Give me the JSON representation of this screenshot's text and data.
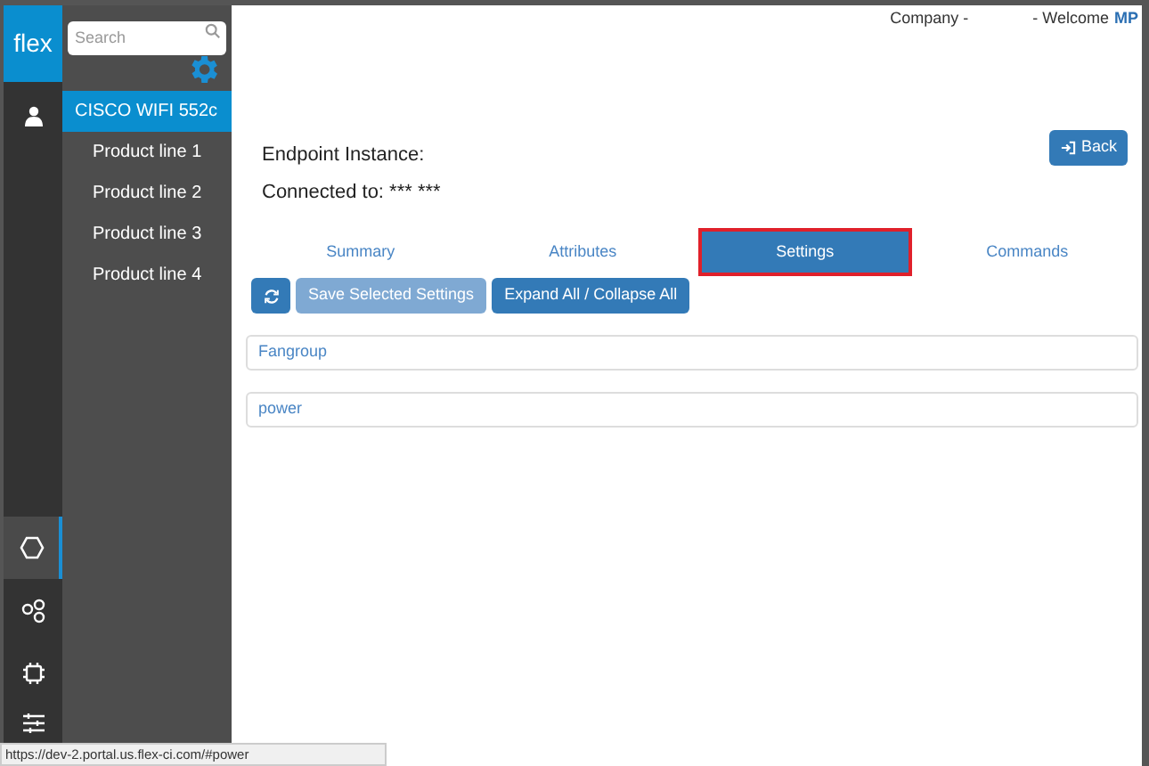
{
  "logo": "flex",
  "rail": [
    {
      "kind": "user",
      "selected": false
    },
    {
      "kind": "hexagon",
      "selected": true
    },
    {
      "kind": "circles",
      "selected": false
    },
    {
      "kind": "chip",
      "selected": false
    },
    {
      "kind": "sliders",
      "selected": false
    }
  ],
  "sidebar": {
    "search": {
      "placeholder": "Search"
    },
    "items": [
      {
        "label": "CISCO WIFI 552c",
        "selected": true
      },
      {
        "label": "Product line 1",
        "selected": false
      },
      {
        "label": "Product line 2",
        "selected": false
      },
      {
        "label": "Product line 3",
        "selected": false
      },
      {
        "label": "Product line 4",
        "selected": false
      }
    ]
  },
  "header": {
    "company": "Company -",
    "welcome": "- Welcome",
    "user": "MP"
  },
  "back_button": "Back",
  "endpoint": {
    "instance": "Endpoint Instance:",
    "connected": "Connected to: *** ***"
  },
  "tabs": [
    {
      "label": "Summary",
      "selected": false
    },
    {
      "label": "Attributes",
      "selected": false
    },
    {
      "label": "Settings",
      "selected": true
    },
    {
      "label": "Commands",
      "selected": false
    }
  ],
  "toolbar": [
    {
      "kind": "refresh",
      "disabled": false
    },
    {
      "kind": "text",
      "label": "Save Selected Settings",
      "disabled": true
    },
    {
      "kind": "text",
      "label": "Expand All / Collapse All",
      "disabled": false
    }
  ],
  "panels": [
    "Fangroup",
    "power"
  ],
  "status_bar": "https://dev-2.portal.us.flex-ci.com/#power"
}
